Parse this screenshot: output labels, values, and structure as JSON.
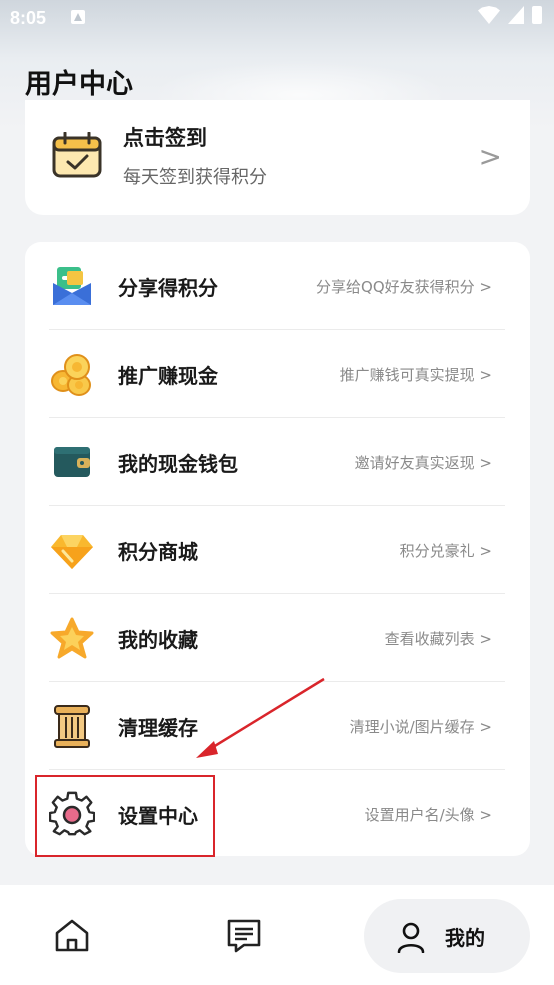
{
  "status_bar": {
    "time": "8:05"
  },
  "header": {
    "title": "用户中心"
  },
  "checkin": {
    "title": "点击签到",
    "subtitle": "每天签到获得积分",
    "chevron": ">"
  },
  "menu": [
    {
      "label": "分享得积分",
      "desc": "分享给QQ好友获得积分 >",
      "icon": "envelope-icon"
    },
    {
      "label": "推广赚现金",
      "desc": "推广赚钱可真实提现 >",
      "icon": "coins-icon"
    },
    {
      "label": "我的现金钱包",
      "desc": "邀请好友真实返现 >",
      "icon": "wallet-icon"
    },
    {
      "label": "积分商城",
      "desc": "积分兑豪礼 >",
      "icon": "diamond-icon"
    },
    {
      "label": "我的收藏",
      "desc": "查看收藏列表 >",
      "icon": "star-icon"
    },
    {
      "label": "清理缓存",
      "desc": "清理小说/图片缓存 >",
      "icon": "pillar-icon"
    },
    {
      "label": "设置中心",
      "desc": "设置用户名/头像 >",
      "icon": "gear-icon"
    }
  ],
  "bottom_nav": {
    "mine_label": "我的"
  },
  "colors": {
    "accent_red": "#d9252b",
    "background": "#f2f3f5"
  }
}
